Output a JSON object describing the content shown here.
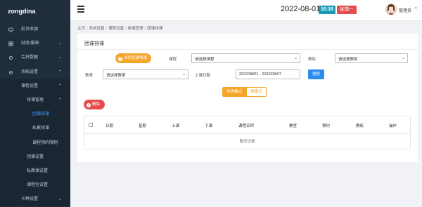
{
  "sidebar": {
    "logo": "zongdina",
    "items": [
      {
        "label": "前台收银",
        "icon": "monitor-icon"
      },
      {
        "label": "财务/报表",
        "icon": "grid-icon",
        "arrow": "⌄"
      },
      {
        "label": "会员数据",
        "icon": "gear-icon",
        "arrow": "⌄"
      },
      {
        "label": "系统设置",
        "icon": "gear-icon",
        "arrow": "⌃"
      },
      {
        "label": "课程设置",
        "arrow": "⌃"
      },
      {
        "label": "排课管理",
        "arrow": "⌃"
      },
      {
        "label": "团课排课"
      },
      {
        "label": "私教排课"
      },
      {
        "label": "课程预约限制"
      },
      {
        "label": "团课设置"
      },
      {
        "label": "私教课设置"
      },
      {
        "label": "课程包设置"
      },
      {
        "label": "卡种设置",
        "arrow": "⌄"
      }
    ]
  },
  "topbar": {
    "date": "2022-08-01",
    "time": "16:16",
    "weekday": "星期一",
    "username": "管理员",
    "caret": "▾"
  },
  "breadcrumb": [
    "主页",
    "系统设置",
    "课程设置",
    "排课管理",
    "团课排课"
  ],
  "breadcrumb_sep": "/",
  "card": {
    "title": "团课排课",
    "add_button": "添加团课排课",
    "add_icon": "+",
    "course_label": "课程",
    "course_value": "请选择课程",
    "coach_label": "教练",
    "coach_value": "请选择教练",
    "room_label": "教室",
    "room_value": "请选择教室",
    "date_label": "上课日期",
    "date_value": "2022/08/01 - 2022/08/07",
    "search_button": "搜索",
    "view_list": "列表模式",
    "view_week": "周模式",
    "delete_button": "删除",
    "delete_icon": "×",
    "select_caret": "⌄"
  },
  "table": {
    "columns": [
      "日期",
      "星期",
      "上课",
      "下课",
      "课程名称",
      "教室",
      "预约",
      "教练",
      "操作"
    ],
    "empty_text": "暂无记录"
  },
  "colors": {
    "sidebar_bg": "#1f2d3d",
    "accent_blue": "#409eff",
    "orange": "#f5a52b",
    "red": "#e64c4c",
    "teal": "#1a9bb4"
  }
}
